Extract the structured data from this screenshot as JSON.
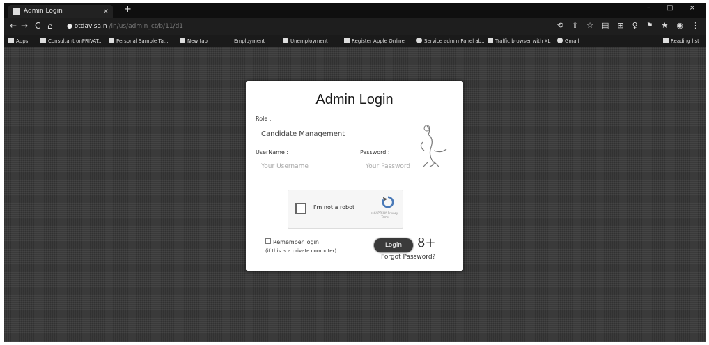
{
  "browser": {
    "tab_title": "Admin Login",
    "tab_close": "×",
    "new_tab": "+",
    "window_controls": "– □ ×",
    "nav": {
      "back": "←",
      "forward": "→",
      "reload": "C",
      "home": "⌂"
    },
    "url_host": "otdavisa.n",
    "url_path": "/in/us/admin_ct/b/11/d1",
    "toolbar_icons": [
      "⟲",
      "⇧",
      "☆",
      "▤",
      "⊞",
      "♀",
      "⚑",
      "★",
      "◉",
      "⋮"
    ]
  },
  "bookmarks": [
    {
      "label": "Apps",
      "icon": "grid"
    },
    {
      "label": "Consultant onPRIVAT...",
      "icon": "square"
    },
    {
      "label": "Personal Sample Ta...",
      "icon": "round"
    },
    {
      "label": "New tab",
      "icon": "round"
    },
    {
      "label": "Employment",
      "icon": ""
    },
    {
      "label": "Unemployment",
      "icon": "round"
    },
    {
      "label": "Register Apple Online",
      "icon": "square"
    },
    {
      "label": "Service admin Panel ab...",
      "icon": "round"
    },
    {
      "label": "Traffic browser with XL",
      "icon": "square"
    },
    {
      "label": "Gmail",
      "icon": "round"
    },
    {
      "label": "Reading list",
      "icon": "square"
    }
  ],
  "login": {
    "title": "Admin Login",
    "role_label": "Role :",
    "role_value": "Candidate Management",
    "username_label": "UserName :",
    "username_placeholder": "Your Username",
    "password_label": "Password :",
    "password_placeholder": "Your Password",
    "captcha_text": "I'm not a robot",
    "captcha_sub": "reCAPTCHA Privacy - Terms",
    "remember_label": "Remember login",
    "private_note": "(if this is a private computer)",
    "login_button": "Login",
    "google_plus": "8+",
    "forgot_password": "Forgot Password?"
  }
}
